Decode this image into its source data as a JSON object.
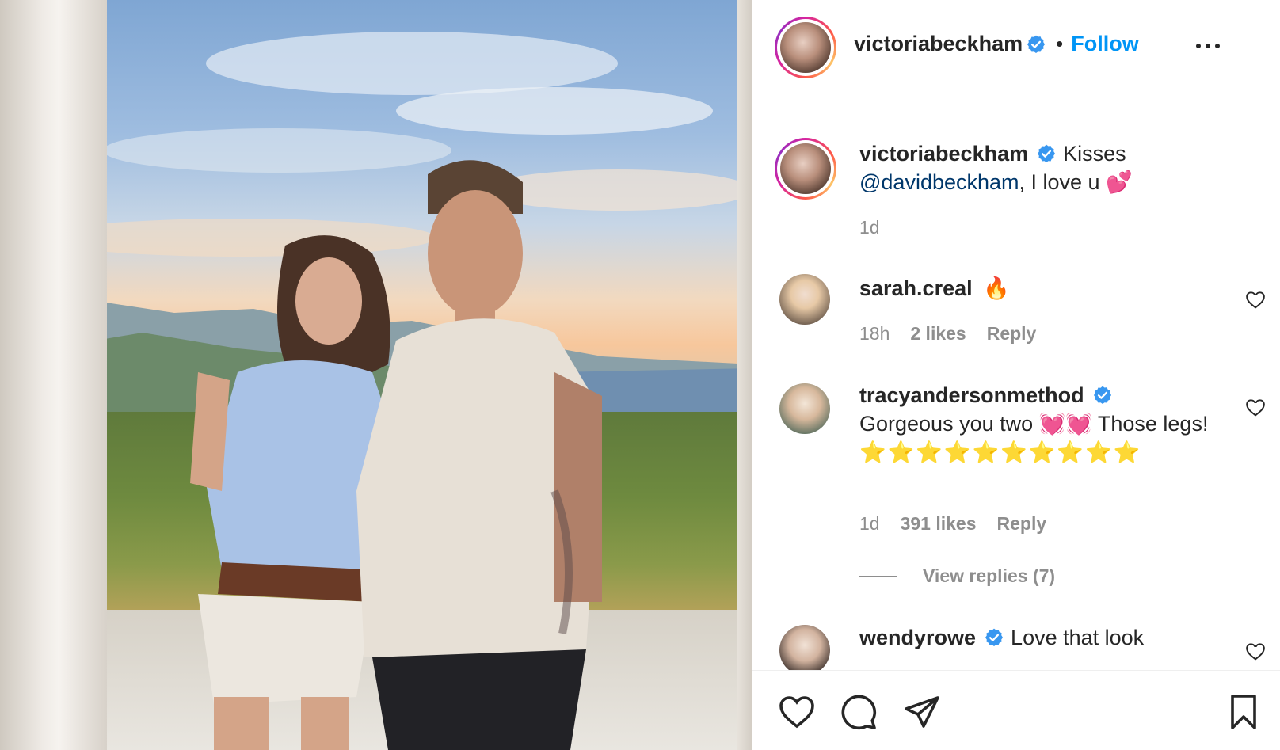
{
  "post": {
    "author": "victoriabeckham",
    "follow_label": "Follow",
    "separator": "•",
    "caption_username": "victoriabeckham",
    "caption_text": "Kisses",
    "caption_mention": "@davidbeckham",
    "caption_suffix": ", I love u",
    "caption_emoji": "💕",
    "time": "1d"
  },
  "comments": [
    {
      "username": "sarah.creal",
      "text": "🔥",
      "time": "18h",
      "likes": "2 likes",
      "reply": "Reply",
      "verified": false
    },
    {
      "username": "tracyandersonmethod",
      "text": "Gorgeous you two 💓💓 Those legs!",
      "stars": "⭐⭐⭐⭐⭐⭐⭐⭐⭐⭐",
      "time": "1d",
      "likes": "391 likes",
      "reply": "Reply",
      "verified": true,
      "view_replies": "View replies (7)"
    },
    {
      "username": "wendyrowe",
      "text": "Love that look",
      "verified": true
    }
  ],
  "colors": {
    "accent": "#0095f6",
    "mention": "#00376b",
    "muted": "#8e8e8e",
    "verified": "#3897f0"
  },
  "icons": [
    "more-options-icon",
    "verified-badge-icon",
    "heart-icon",
    "comment-icon",
    "share-icon",
    "bookmark-icon"
  ]
}
